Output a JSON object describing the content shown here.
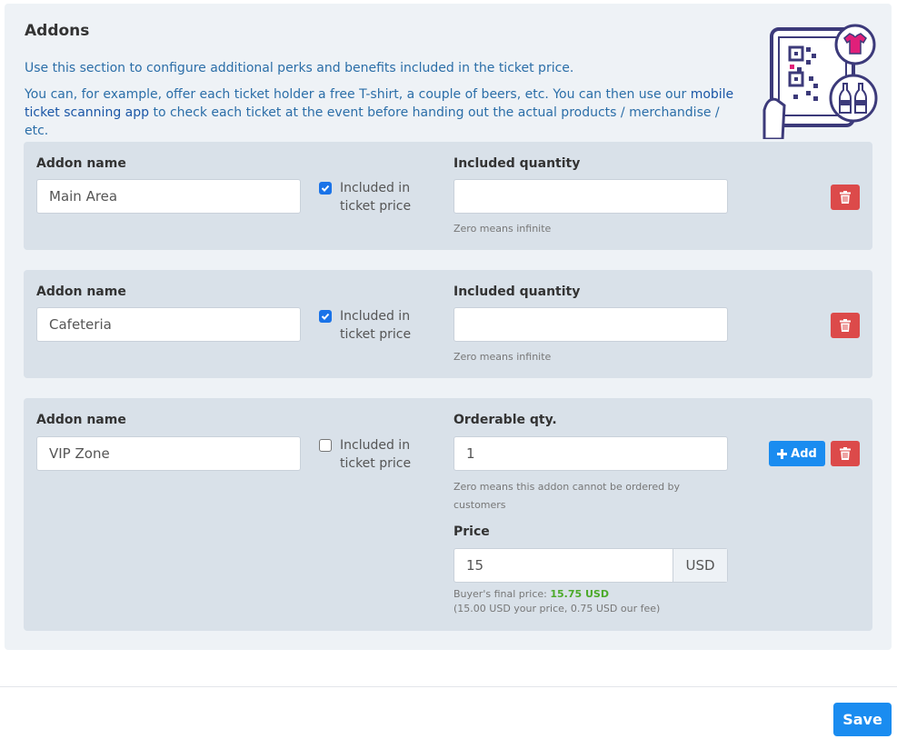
{
  "section": {
    "title": "Addons",
    "intro_1": "Use this section to configure additional perks and benefits included in the ticket price.",
    "intro_2_a": "You can, for example, offer each ticket holder a free T-shirt, a couple of beers, etc. You can then use our ",
    "intro_2_link": "mobile ticket scanning app",
    "intro_2_b": " to check each ticket at the event before handing out the actual products / merchandise / etc."
  },
  "addons": [
    {
      "name_label": "Addon name",
      "name_value": "Main Area",
      "included_label": "Included in ticket price",
      "included": true,
      "qty_label": "Included quantity",
      "qty_value": "",
      "qty_help": "Zero means infinite"
    },
    {
      "name_label": "Addon name",
      "name_value": "Cafeteria",
      "included_label": "Included in ticket price",
      "included": true,
      "qty_label": "Included quantity",
      "qty_value": "",
      "qty_help": "Zero means infinite"
    },
    {
      "name_label": "Addon name",
      "name_value": "VIP Zone",
      "included_label": "Included in ticket price",
      "included": false,
      "qty_label": "Orderable qty.",
      "qty_value": "1",
      "qty_help": "Zero means this addon cannot be ordered by customers",
      "add_label": "Add",
      "price_label": "Price",
      "price_value": "15",
      "currency": "USD",
      "final_prefix": "Buyer's final price: ",
      "final_value": "15.75 USD",
      "final_breakdown": "(15.00 USD your price, 0.75 USD our fee)"
    }
  ],
  "footer": {
    "save_label": "Save"
  },
  "colors": {
    "panel_bg": "#eef2f6",
    "card_bg": "#d9e1e9",
    "primary": "#1a8cf0",
    "danger": "#dc4a4a",
    "link": "#1a56a6",
    "price_green": "#4caa2a"
  },
  "icons": {
    "delete": "trash-icon",
    "add": "plus-icon",
    "checkbox": "check-icon",
    "illustration": "ticket-scan-illustration"
  }
}
